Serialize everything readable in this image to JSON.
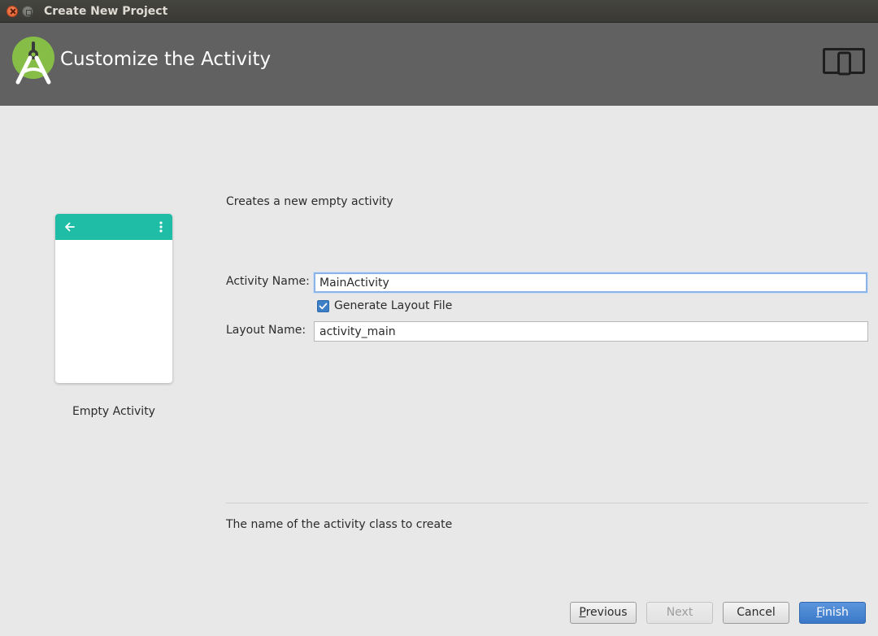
{
  "window": {
    "title": "Create New Project"
  },
  "header": {
    "title": "Customize the Activity"
  },
  "preview": {
    "template_name": "Empty Activity",
    "accent_color": "#1fbda5"
  },
  "form": {
    "description": "Creates a new empty activity",
    "activity_name_label": "Activity Name:",
    "activity_name_value": "MainActivity",
    "generate_layout_label": "Generate Layout File",
    "generate_layout_checked": true,
    "layout_name_label": "Layout Name:",
    "layout_name_value": "activity_main"
  },
  "help": {
    "text": "The name of the activity class to create"
  },
  "buttons": {
    "previous_mnemonic": "P",
    "previous_rest": "revious",
    "next": "Next",
    "cancel": "Cancel",
    "finish_mnemonic": "F",
    "finish_rest": "inish"
  },
  "icons": {
    "logo": "android-studio-logo",
    "device": "device-form-factor-icon",
    "back": "arrow-back-icon",
    "more": "more-vert-icon",
    "check": "check-icon"
  }
}
